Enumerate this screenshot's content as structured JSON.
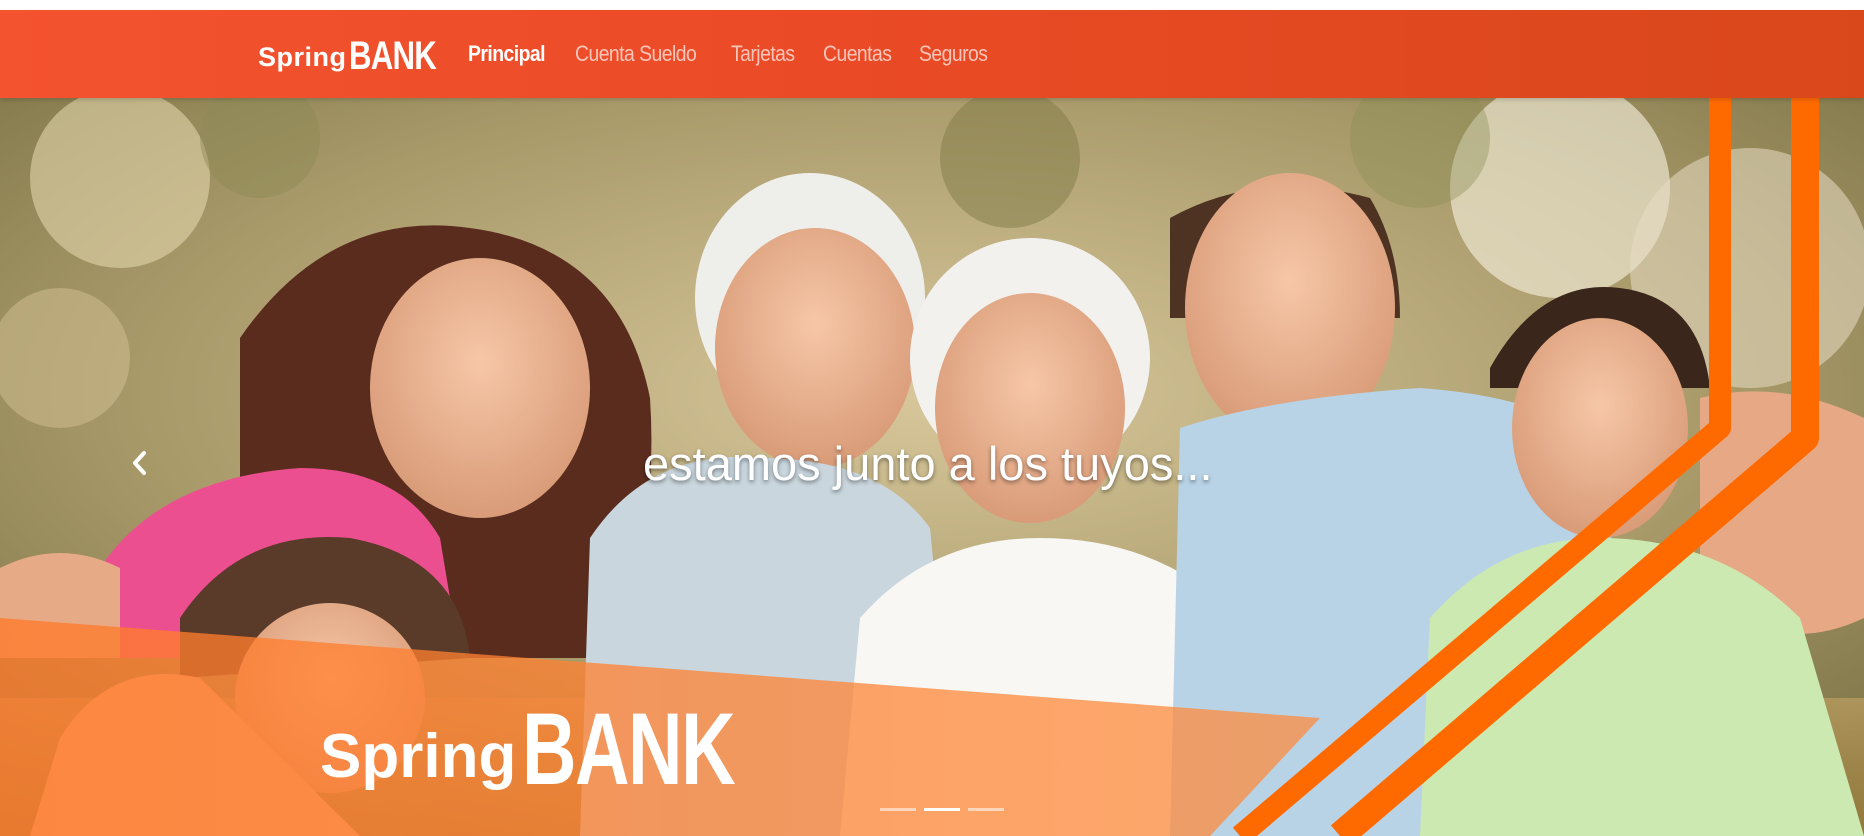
{
  "brand": {
    "name_part1": "Spring",
    "name_part2": "BANK",
    "primary_color": "#e84c24",
    "accent_color": "#ff6a00"
  },
  "nav": {
    "items": [
      {
        "label": "Principal",
        "active": true
      },
      {
        "label": "Cuenta Sueldo",
        "active": false
      },
      {
        "label": "Tarjetas",
        "active": false
      },
      {
        "label": "Cuentas",
        "active": false
      },
      {
        "label": "Seguros",
        "active": false
      }
    ]
  },
  "hero": {
    "headline": "estamos junto a los tuyos...",
    "image_subject": "smiling multigenerational family outdoors",
    "prev_icon": "chevron-left-icon",
    "indicators": {
      "count": 3,
      "active_index": 1
    },
    "logo": {
      "part1": "Spring",
      "part2": "BANK"
    }
  }
}
